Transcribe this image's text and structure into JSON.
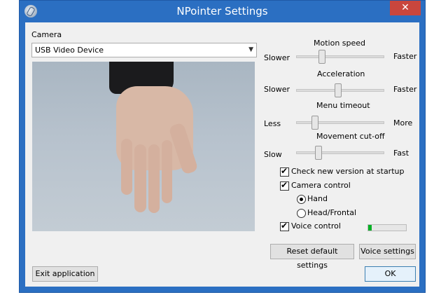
{
  "window": {
    "title": "NPointer Settings",
    "close": "✕"
  },
  "camera": {
    "label": "Camera",
    "selected": "USB Video Device"
  },
  "sliders": [
    {
      "title": "Motion speed",
      "left": "Slower",
      "right": "Faster",
      "value": 0.28
    },
    {
      "title": "Acceleration",
      "left": "Slower",
      "right": "Faster",
      "value": 0.47
    },
    {
      "title": "Menu timeout",
      "left": "Less",
      "right": "More",
      "value": 0.19
    },
    {
      "title": "Movement cut-off",
      "left": "Slow",
      "right": "Fast",
      "value": 0.23
    }
  ],
  "options": {
    "check_version": {
      "label": "Check new version at startup",
      "checked": true
    },
    "camera_control": {
      "label": "Camera control",
      "checked": true
    },
    "hand": {
      "label": "Hand",
      "selected": true
    },
    "head": {
      "label": "Head/Frontal",
      "selected": false
    },
    "voice_control": {
      "label": "Voice control",
      "checked": true,
      "level": 0.1
    }
  },
  "buttons": {
    "reset": "Reset default settings",
    "voice": "Voice settings",
    "exit": "Exit application",
    "ok": "OK"
  },
  "colors": {
    "titlebar": "#2b6fc2",
    "close": "#c9463d",
    "level": "#06b025"
  }
}
